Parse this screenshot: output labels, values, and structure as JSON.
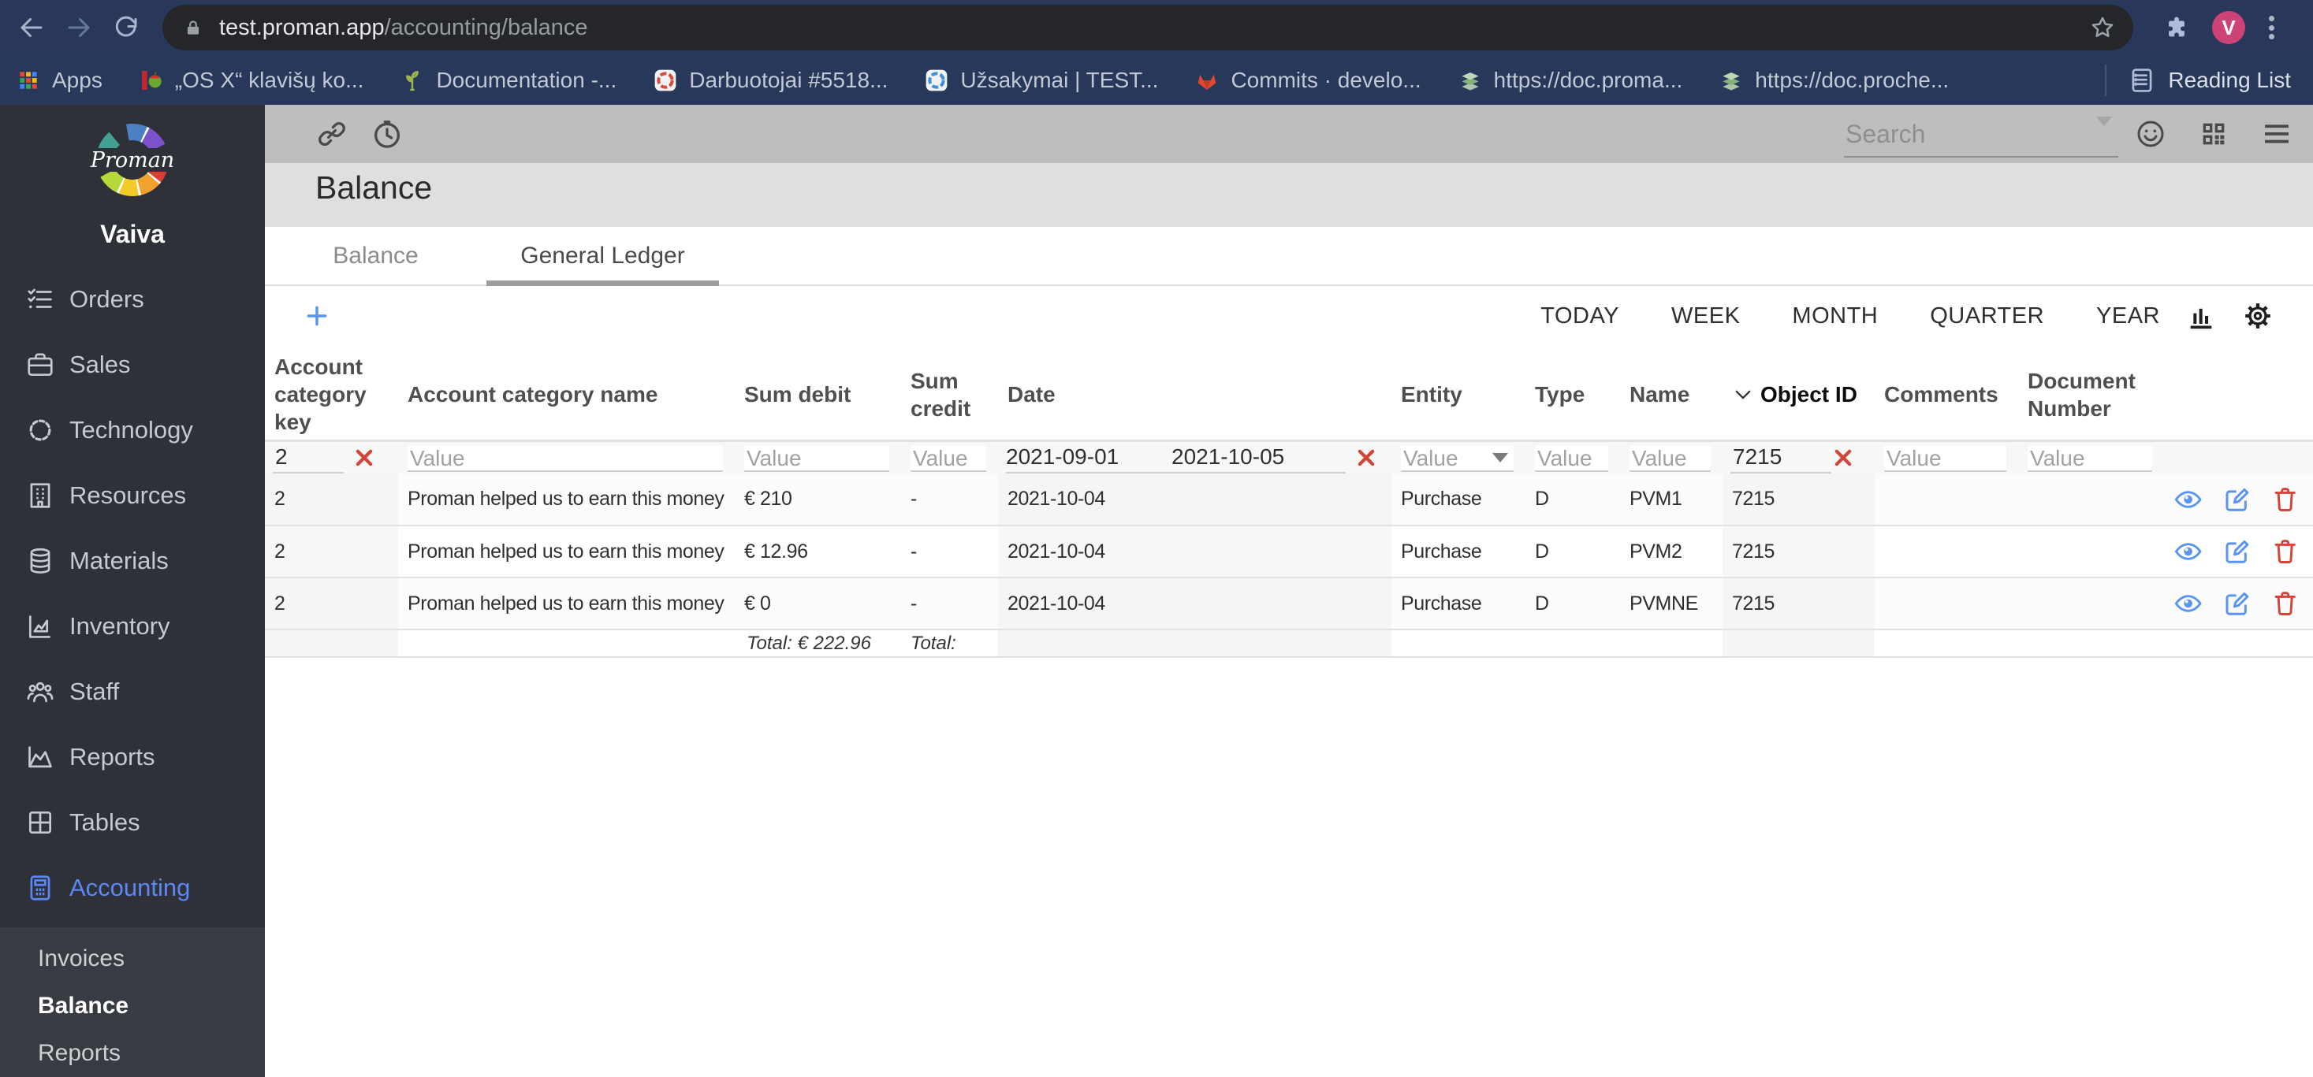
{
  "browser": {
    "host": "test.proman.app",
    "path": "/accounting/balance",
    "profile_initial": "V",
    "bookmarks": [
      "Apps",
      "„OS X“ klavišų ko...",
      "Documentation -...",
      "Darbuotojai #5518...",
      "Užsakymai | TEST...",
      "Commits · develo...",
      "https://doc.proma...",
      "https://doc.proche..."
    ],
    "reading_list": "Reading List"
  },
  "sidebar": {
    "logo_text": "Proman",
    "username": "Vaiva",
    "items": [
      {
        "label": "Orders"
      },
      {
        "label": "Sales"
      },
      {
        "label": "Technology"
      },
      {
        "label": "Resources"
      },
      {
        "label": "Materials"
      },
      {
        "label": "Inventory"
      },
      {
        "label": "Staff"
      },
      {
        "label": "Reports"
      },
      {
        "label": "Tables"
      },
      {
        "label": "Accounting"
      }
    ],
    "submenu": [
      {
        "label": "Invoices"
      },
      {
        "label": "Balance"
      },
      {
        "label": "Reports"
      }
    ]
  },
  "topbar": {
    "search_placeholder": "Search"
  },
  "page": {
    "title": "Balance",
    "tabs": [
      {
        "label": "Balance"
      },
      {
        "label": "General Ledger"
      }
    ]
  },
  "controls": {
    "ranges": [
      "TODAY",
      "WEEK",
      "MONTH",
      "QUARTER",
      "YEAR"
    ]
  },
  "table": {
    "headers": [
      "Account category key",
      "Account category name",
      "Sum debit",
      "Sum credit",
      "Date",
      "Entity",
      "Type",
      "Name",
      "Object ID",
      "Comments",
      "Document Number"
    ],
    "filter": {
      "key": "2",
      "name_placeholder": "Value",
      "debit_placeholder": "Value",
      "credit_placeholder": "Value",
      "date_from": "2021-09-01",
      "date_to": "2021-10-05",
      "entity_placeholder": "Value",
      "type_placeholder": "Value",
      "tname_placeholder": "Value",
      "object_id": "7215",
      "comments_placeholder": "Value",
      "document_placeholder": "Value"
    },
    "rows": [
      {
        "key": "2",
        "name": "Proman helped us to earn this money",
        "debit": "€ 210",
        "credit": "-",
        "date": "2021-10-04",
        "entity": "Purchase",
        "type": "D",
        "tname": "PVM1",
        "object_id": "7215",
        "comments": "",
        "document": ""
      },
      {
        "key": "2",
        "name": "Proman helped us to earn this money",
        "debit": "€ 12.96",
        "credit": "-",
        "date": "2021-10-04",
        "entity": "Purchase",
        "type": "D",
        "tname": "PVM2",
        "object_id": "7215",
        "comments": "",
        "document": ""
      },
      {
        "key": "2",
        "name": "Proman helped us to earn this money",
        "debit": "€ 0",
        "credit": "-",
        "date": "2021-10-04",
        "entity": "Purchase",
        "type": "D",
        "tname": "PVMNE",
        "object_id": "7215",
        "comments": "",
        "document": ""
      }
    ],
    "totals": {
      "debit": "Total: € 222.96",
      "credit": "Total:"
    }
  }
}
